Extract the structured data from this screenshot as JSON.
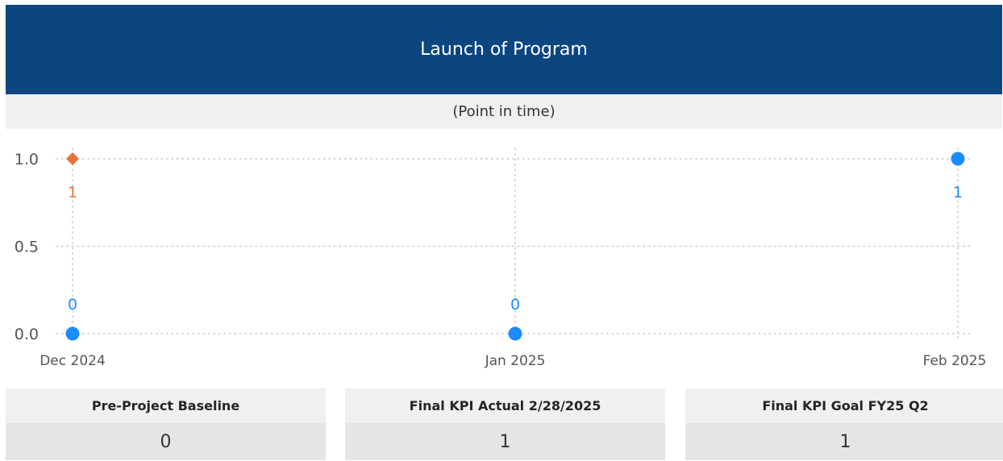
{
  "header": {
    "title": "Launch of Program",
    "subtitle": "(Point in time)"
  },
  "chart_data": {
    "type": "scatter",
    "title": "Launch of Program",
    "subtitle": "(Point in time)",
    "x_categories": [
      "Dec 2024",
      "Jan 2025",
      "Feb 2025"
    ],
    "y_ticks": [
      "0.0",
      "0.5",
      "1.0"
    ],
    "ylim": [
      0,
      1
    ],
    "grid": true,
    "grid_style": "dotted",
    "series": [
      {
        "color": "#1a8cff",
        "marker": "circle",
        "points": [
          {
            "x": "Dec 2024",
            "y": 0,
            "label": "0"
          },
          {
            "x": "Jan 2025",
            "y": 0,
            "label": "0"
          },
          {
            "x": "Feb 2025",
            "y": 1,
            "label": "1"
          }
        ]
      },
      {
        "color": "#e8733a",
        "marker": "diamond",
        "points": [
          {
            "x": "Dec 2024",
            "y": 1,
            "label": "1"
          }
        ]
      }
    ]
  },
  "kpi_cards": [
    {
      "title": "Pre-Project Baseline",
      "value": "0"
    },
    {
      "title": "Final KPI Actual 2/28/2025",
      "value": "1"
    },
    {
      "title": "Final KPI Goal FY25 Q2",
      "value": "1"
    }
  ],
  "colors": {
    "header_bg": "#0b4680",
    "subtitle_bg": "#f0f0f0",
    "card_title_bg": "#f0f0f0",
    "card_value_bg": "#e5e5e5",
    "series_blue": "#1a8cff",
    "series_orange": "#e8733a"
  }
}
